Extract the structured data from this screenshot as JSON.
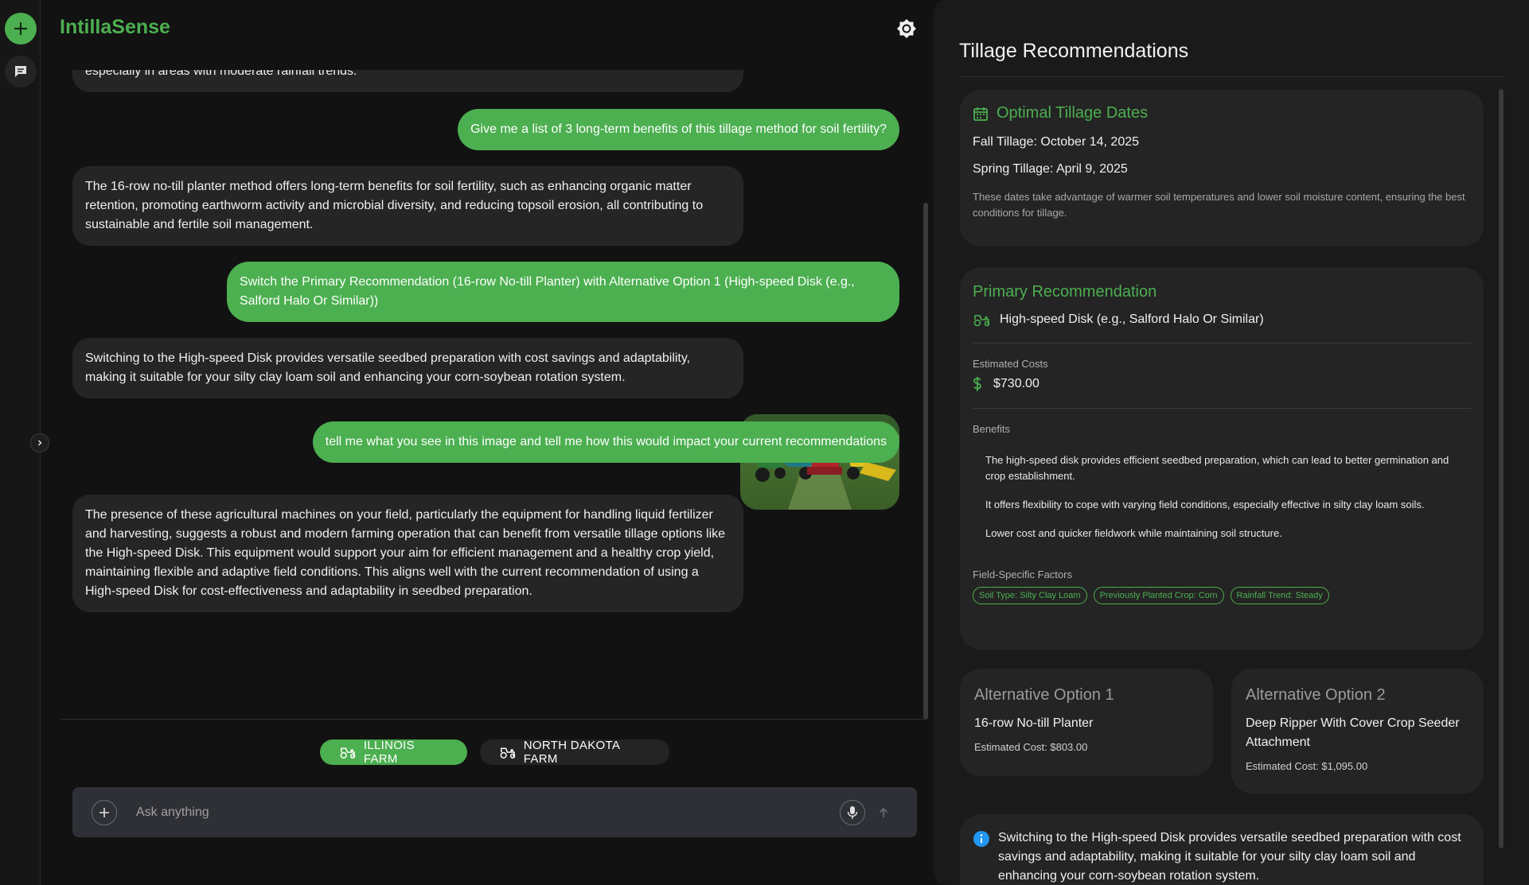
{
  "app": {
    "name": "IntillaSense"
  },
  "chat": {
    "messages": [
      {
        "role": "ai",
        "text": "especially in areas with moderate rainfall trends."
      },
      {
        "role": "user",
        "text": "Give me a list of 3 long-term benefits of this tillage method for soil fertility?"
      },
      {
        "role": "ai",
        "text": "The 16-row no-till planter method offers long-term benefits for soil fertility, such as enhancing organic matter retention, promoting earthworm activity and microbial diversity, and reducing topsoil erosion, all contributing to sustainable and fertile soil management."
      },
      {
        "role": "user",
        "text": "Switch the Primary Recommendation (16-row No-till Planter) with Alternative Option 1 (High-speed Disk (e.g., Salford Halo Or Similar))"
      },
      {
        "role": "ai",
        "text": "Switching to the High-speed Disk provides versatile seedbed preparation with cost savings and adaptability, making it suitable for your silty clay loam soil and enhancing your corn-soybean rotation system."
      },
      {
        "role": "user",
        "text": "tell me what you see in this image and tell me how this would impact your current recommendations"
      },
      {
        "role": "ai",
        "text": "The presence of these agricultural machines on your field, particularly the equipment for handling liquid fertilizer and harvesting, suggests a robust and modern farming operation that can benefit from versatile tillage options like the High-speed Disk. This equipment would support your aim for efficient management and a healthy crop yield, maintaining flexible and adaptive field conditions. This aligns well with the current recommendation of using a High-speed Disk for cost-effectiveness and adaptability in seedbed preparation."
      }
    ]
  },
  "farms": [
    {
      "label": "ILLINOIS FARM",
      "active": true
    },
    {
      "label": "NORTH DAKOTA FARM",
      "active": false
    }
  ],
  "composer": {
    "placeholder": "Ask anything"
  },
  "panel": {
    "title": "Tillage Recommendations",
    "dates": {
      "title": "Optimal Tillage Dates",
      "fall": "Fall Tillage: October 14, 2025",
      "spring": "Spring Tillage: April 9, 2025",
      "note": "These dates take advantage of warmer soil temperatures and lower soil moisture content, ensuring the best conditions for tillage."
    },
    "primary": {
      "title": "Primary Recommendation",
      "equipment": "High-speed Disk (e.g., Salford Halo Or Similar)",
      "costs_label": "Estimated Costs",
      "cost": "$730.00",
      "benefits_label": "Benefits",
      "benefits": [
        "The high-speed disk provides efficient seedbed preparation, which can lead to better germination and crop establishment.",
        "It offers flexibility to cope with varying field conditions, especially effective in silty clay loam soils.",
        "Lower cost and quicker fieldwork while maintaining soil structure."
      ],
      "factors_label": "Field-Specific Factors",
      "factors": [
        "Soil Type: Silty Clay Loam",
        "Previously Planted Crop: Corn",
        "Rainfall Trend: Steady"
      ]
    },
    "alternatives": [
      {
        "title": "Alternative Option 1",
        "name": "16-row No-till Planter",
        "cost": "Estimated Cost: $803.00"
      },
      {
        "title": "Alternative Option 2",
        "name": "Deep Ripper With Cover Crop Seeder Attachment",
        "cost": "Estimated Cost: $1,095.00"
      }
    ],
    "summary": "Switching to the High-speed Disk provides versatile seedbed preparation with cost savings and adaptability, making it suitable for your silty clay loam soil and enhancing your corn-soybean rotation system."
  },
  "colors": {
    "accent": "#4caf50",
    "background": "#121212",
    "panel": "#1a1a1a",
    "card": "#242424",
    "info": "#2196f3"
  }
}
